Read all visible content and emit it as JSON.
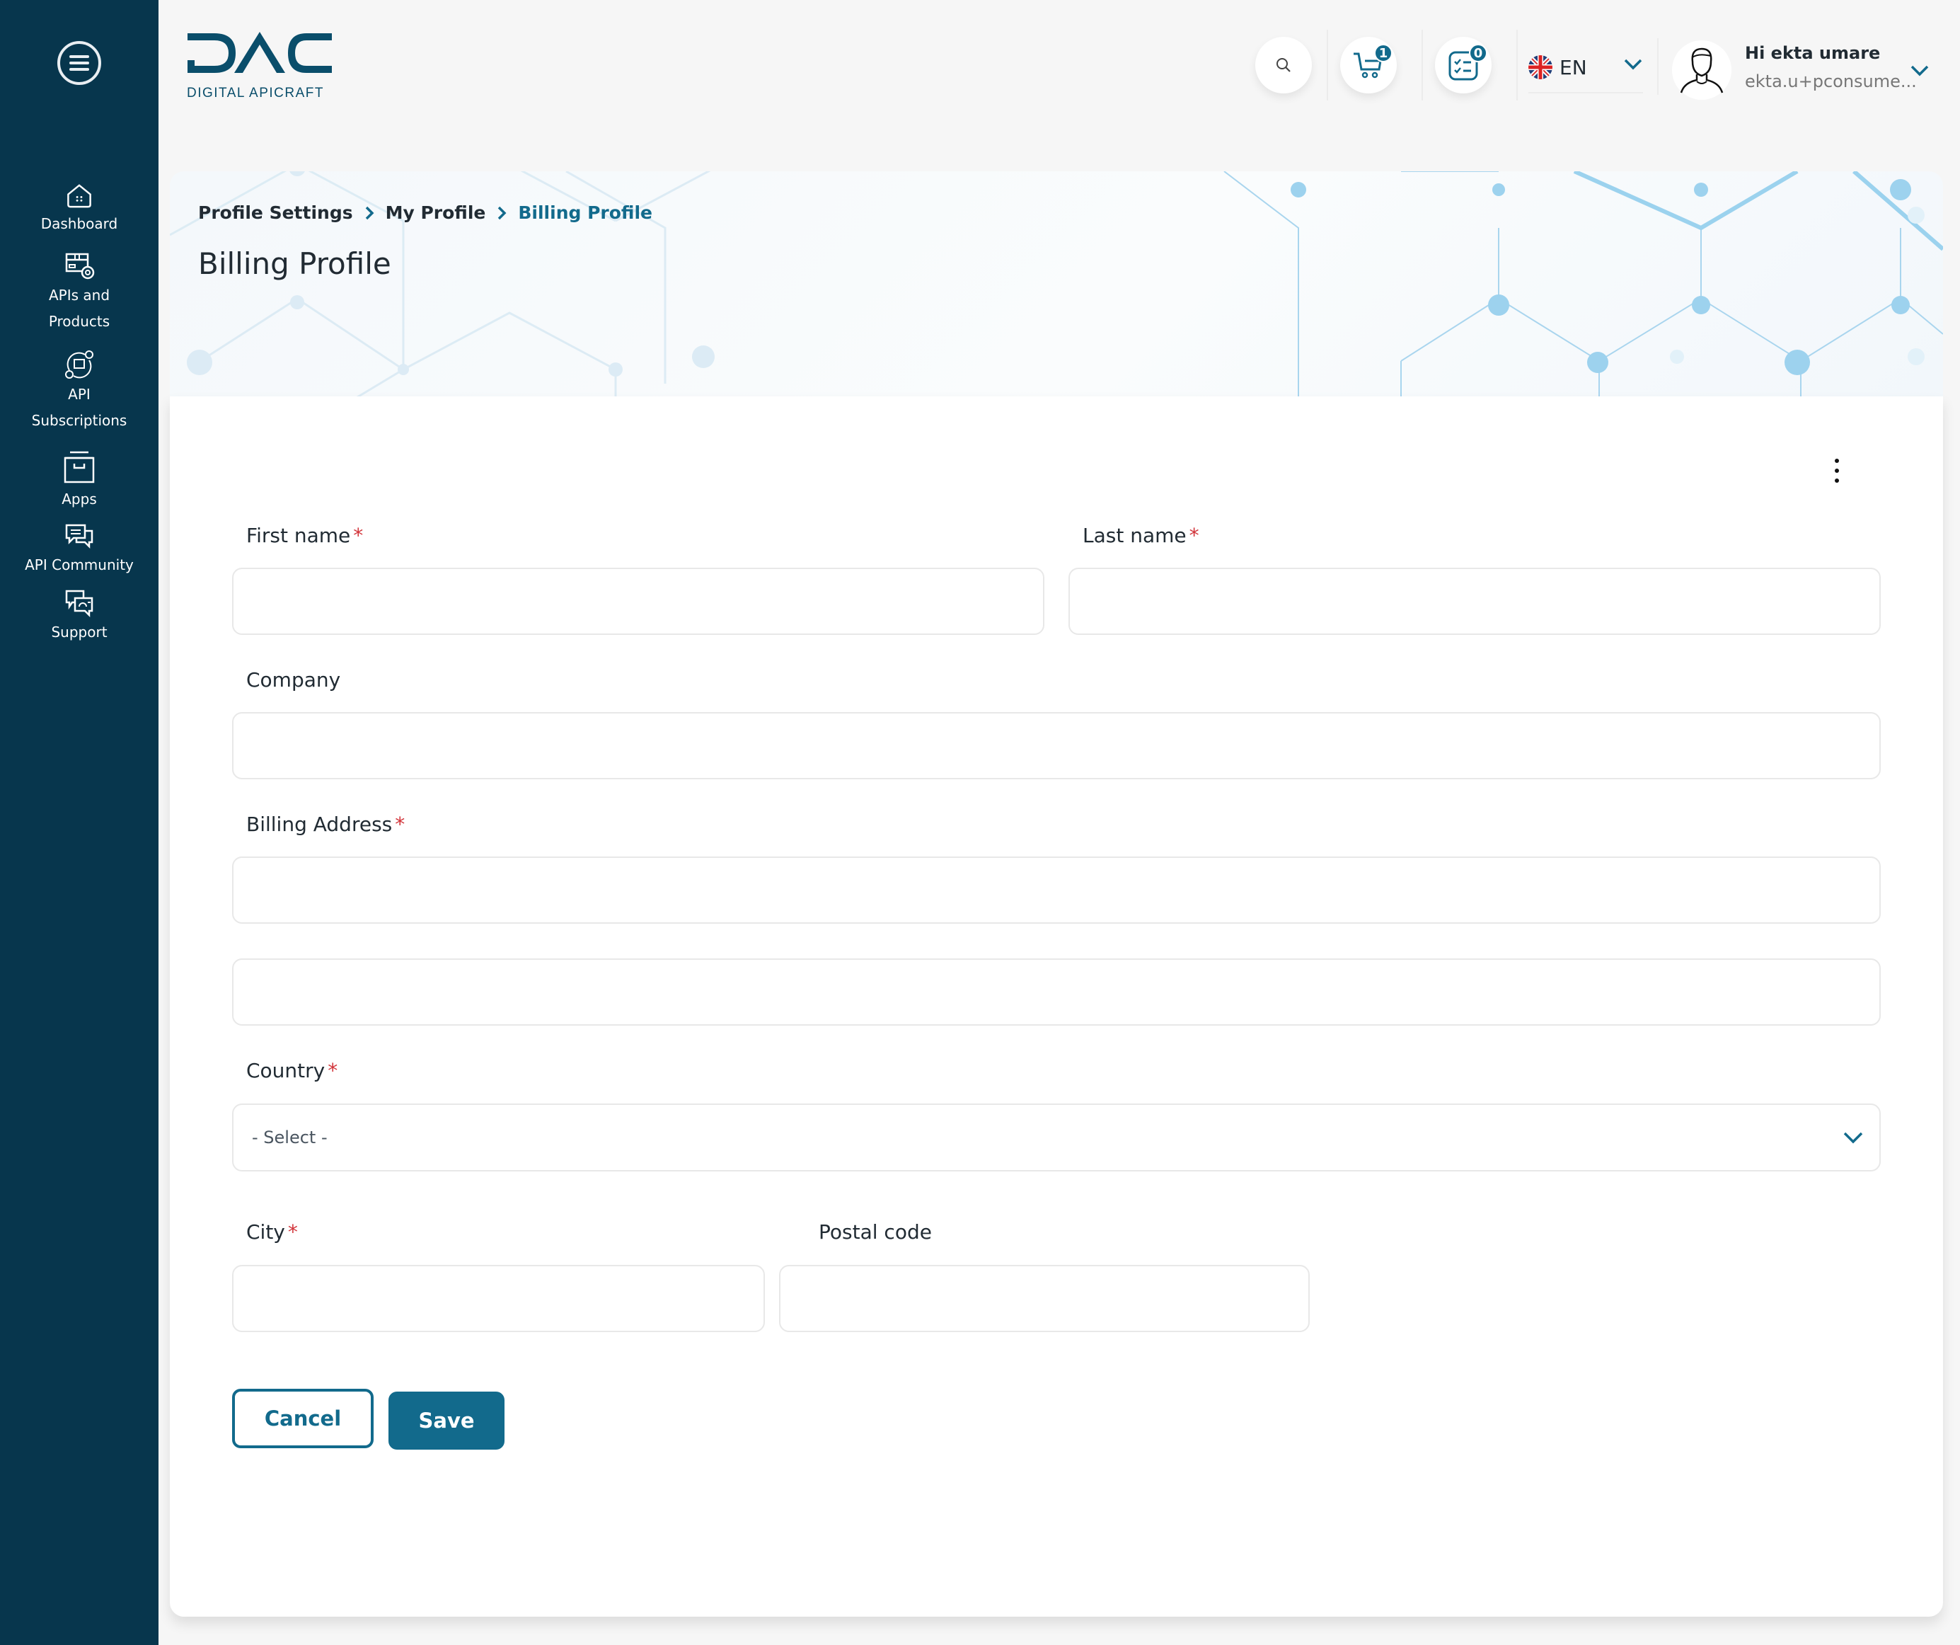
{
  "app": {
    "logo_text": "DAC",
    "logo_subtext": "DIGITAL APICRAFT",
    "brand_color": "#126a8c",
    "sidebar_color": "#07364d"
  },
  "sidebar": {
    "items": [
      {
        "label": "Dashboard",
        "icon": "home-icon"
      },
      {
        "label": "APIs and Products",
        "icon": "api-products-icon"
      },
      {
        "label": "API Subscriptions",
        "icon": "subscriptions-icon"
      },
      {
        "label": "Apps",
        "icon": "archive-box-icon"
      },
      {
        "label": "API Community",
        "icon": "chat-bubbles-icon"
      },
      {
        "label": "Support",
        "icon": "support-chat-icon"
      }
    ]
  },
  "header": {
    "cart_count": "1",
    "tasks_count": "0",
    "language": "EN",
    "greeting": "Hi ekta umare",
    "email": "ekta.u+pconsume..."
  },
  "breadcrumb": [
    "Profile Settings",
    "My Profile",
    "Billing Profile"
  ],
  "page": {
    "title": "Billing Profile"
  },
  "form": {
    "first_name": {
      "label": "First name",
      "required": "*",
      "value": ""
    },
    "last_name": {
      "label": "Last name",
      "required": "*",
      "value": ""
    },
    "company": {
      "label": "Company",
      "value": ""
    },
    "billing_address": {
      "label": "Billing Address",
      "required": "*",
      "line1": "",
      "line2": ""
    },
    "country": {
      "label": "Country",
      "required": "*",
      "selected": "- Select -"
    },
    "city": {
      "label": "City",
      "required": "*",
      "value": ""
    },
    "postal_code": {
      "label": "Postal code",
      "value": ""
    },
    "cancel_label": "Cancel",
    "save_label": "Save"
  }
}
